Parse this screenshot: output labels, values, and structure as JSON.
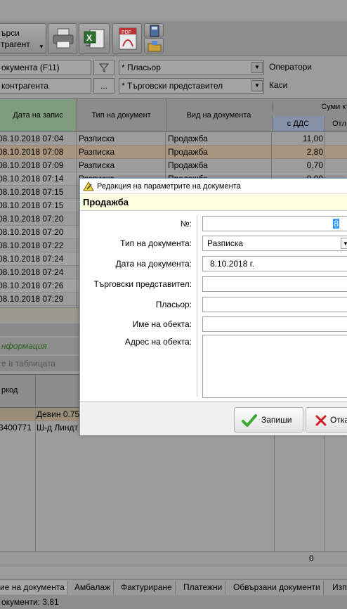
{
  "toolbar": {
    "search_label_line1": "ърси",
    "search_label_line2": "трагент"
  },
  "filters": {
    "documents": "окумента (F11)",
    "contragent": "контрагента",
    "browse": "...",
    "placer": "* Пласьор",
    "sales_rep": "* Търговски представител",
    "operators": "Оператори",
    "cash": "Каси"
  },
  "grid": {
    "headers": {
      "date": "Дата на запис",
      "doc_type": "Тип на документ",
      "doc_kind": "Вид на документа",
      "sums": "Суми къ",
      "with_vat": "с ДДС",
      "other": "Отл"
    },
    "rows": [
      {
        "date": "08.10.2018 07:04",
        "type": "Разписка",
        "kind": "Продажба",
        "amount": "11,00"
      },
      {
        "date": "08.10.2018 07:08",
        "type": "Разписка",
        "kind": "Продажба",
        "amount": "2,80"
      },
      {
        "date": "08.10.2018 07:09",
        "type": "Разписка",
        "kind": "Продажба",
        "amount": "0,70"
      },
      {
        "date": "08.10.2018 07:14",
        "type": "Разписка",
        "kind": "Продажба",
        "amount": "8,00"
      },
      {
        "date": "08.10.2018 07:15",
        "type": "",
        "kind": "",
        "amount": ""
      },
      {
        "date": "08.10.2018 07:15",
        "type": "",
        "kind": "",
        "amount": ""
      },
      {
        "date": "08.10.2018 07:20",
        "type": "",
        "kind": "",
        "amount": ""
      },
      {
        "date": "08.10.2018 07:20",
        "type": "",
        "kind": "",
        "amount": ""
      },
      {
        "date": "08.10.2018 07:22",
        "type": "",
        "kind": "",
        "amount": ""
      },
      {
        "date": "08.10.2018 07:24",
        "type": "",
        "kind": "",
        "amount": ""
      },
      {
        "date": "08.10.2018 07:24",
        "type": "",
        "kind": "",
        "amount": ""
      },
      {
        "date": "08.10.2018 07:26",
        "type": "",
        "kind": "",
        "amount": ""
      },
      {
        "date": "08.10.2018 07:29",
        "type": "",
        "kind": "",
        "amount": ""
      }
    ]
  },
  "info": {
    "label": "нформация",
    "search_table": "е в таблицата"
  },
  "subgrid": {
    "header_code": "ркод",
    "rows": [
      {
        "code": "",
        "name": "Девин 0.75"
      },
      {
        "code": "3400771",
        "name": "Ш-д Линдт"
      }
    ],
    "footer_total": "0"
  },
  "tabs": [
    "ие на документа",
    "Амбалаж",
    "Фактуриране",
    "Платежни",
    "Обвързани документи",
    "Изп"
  ],
  "status": "окументи: 3,81",
  "dialog": {
    "title": "Редакция на параметрите на документа",
    "header": "Продажба",
    "labels": {
      "number": "№:",
      "doc_type": "Тип на документа:",
      "doc_date": "Дата на документа:",
      "sales_rep": "Търговски представител:",
      "placer": "Пласьор:",
      "object_name": "Име на обекта:",
      "object_address": "Адрес на обекта:"
    },
    "values": {
      "number": "8",
      "doc_type": "Разписка",
      "doc_date": "8.10.2018 г.",
      "sales_rep": "",
      "placer": "",
      "object_name": "",
      "object_address": ""
    },
    "save_button": "Запиши",
    "cancel_button": "Отка"
  },
  "colors": {
    "dialog_header_bg": "#ffffe1",
    "selection": "#3399ff",
    "save_check": "#3aa82e",
    "cancel_x": "#d21f1f"
  }
}
